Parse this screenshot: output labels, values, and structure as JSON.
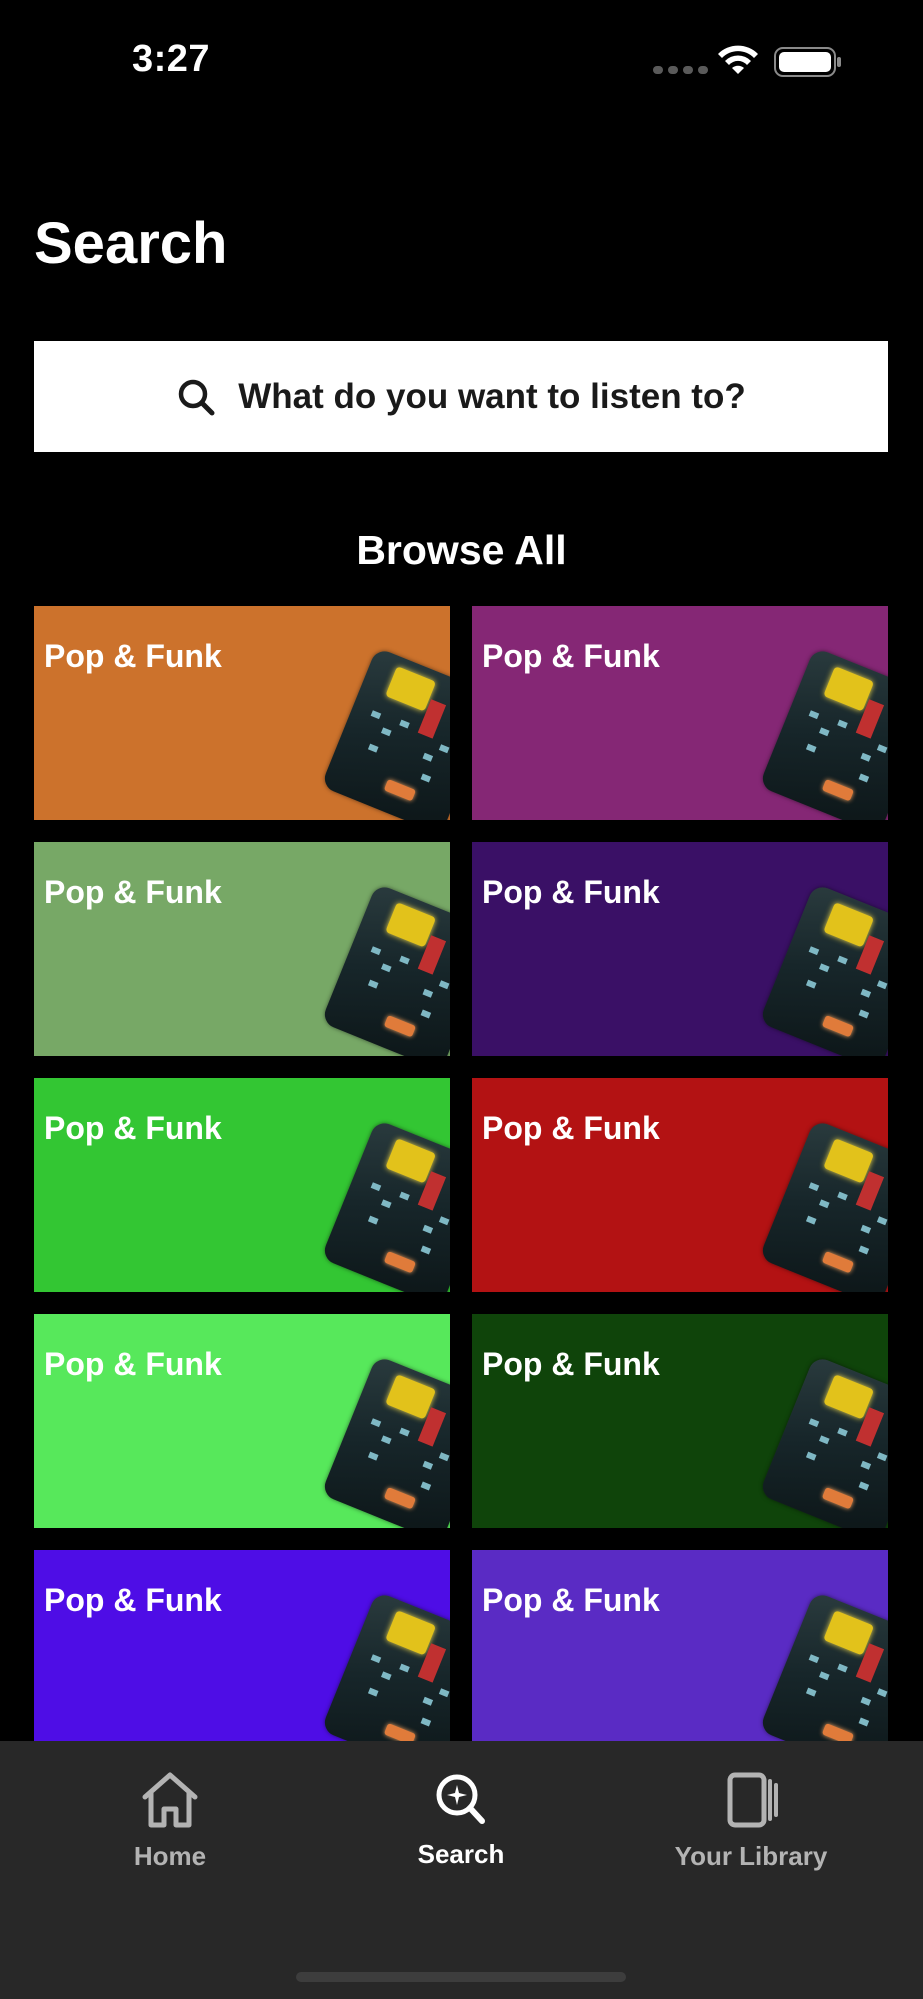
{
  "status_bar": {
    "time": "3:27"
  },
  "page": {
    "title": "Search"
  },
  "search": {
    "placeholder": "What do you want to listen to?"
  },
  "browse": {
    "title": "Browse All",
    "categories": [
      {
        "label": "Pop & Funk",
        "color": "#CC722C"
      },
      {
        "label": "Pop & Funk",
        "color": "#852775"
      },
      {
        "label": "Pop & Funk",
        "color": "#77A866"
      },
      {
        "label": "Pop & Funk",
        "color": "#3A1066"
      },
      {
        "label": "Pop & Funk",
        "color": "#33C633"
      },
      {
        "label": "Pop & Funk",
        "color": "#B31213"
      },
      {
        "label": "Pop & Funk",
        "color": "#57E85B"
      },
      {
        "label": "Pop & Funk",
        "color": "#0F440A"
      },
      {
        "label": "Pop & Funk",
        "color": "#4E0DE6"
      },
      {
        "label": "Pop & Funk",
        "color": "#5A2BC4"
      }
    ]
  },
  "tab_bar": {
    "tabs": [
      {
        "label": "Home",
        "icon": "home-icon",
        "active": false
      },
      {
        "label": "Search",
        "icon": "search-icon",
        "active": true
      },
      {
        "label": "Your Library",
        "icon": "library-icon",
        "active": false
      }
    ]
  },
  "colors": {
    "background": "#000000",
    "search_box": "#FFFFFF",
    "tab_bar": "#282828",
    "tab_active": "#FFFFFF",
    "tab_inactive": "#B3B3B3"
  }
}
